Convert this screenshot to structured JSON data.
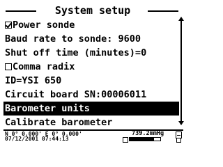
{
  "header": {
    "title": "System setup"
  },
  "menu": {
    "items": [
      {
        "label": "Power sonde",
        "checkbox": true,
        "checked": true
      },
      {
        "label": "Baud rate to sonde: 9600"
      },
      {
        "label": "Shut off time (minutes)=0"
      },
      {
        "label": "Comma radix",
        "checkbox": true,
        "checked": false
      },
      {
        "label": "ID=YSI 650"
      },
      {
        "label": "Circuit board SN:00006011"
      },
      {
        "label": "Barometer units",
        "selected": true
      },
      {
        "label": "Calibrate barometer"
      }
    ]
  },
  "status": {
    "gps": "N 0° 0.000' E 0° 0.000'",
    "datetime": "07/12/2001 07:44:13",
    "pressure": "739.2mmHg",
    "battery_level": 0.8
  },
  "icons": {
    "checkbox_checked": "checkbox-checked-icon",
    "checkbox_unchecked": "checkbox-unchecked-icon",
    "scroll_up": "scroll-up-arrow-icon",
    "scroll_down": "scroll-down-arrow-icon"
  }
}
